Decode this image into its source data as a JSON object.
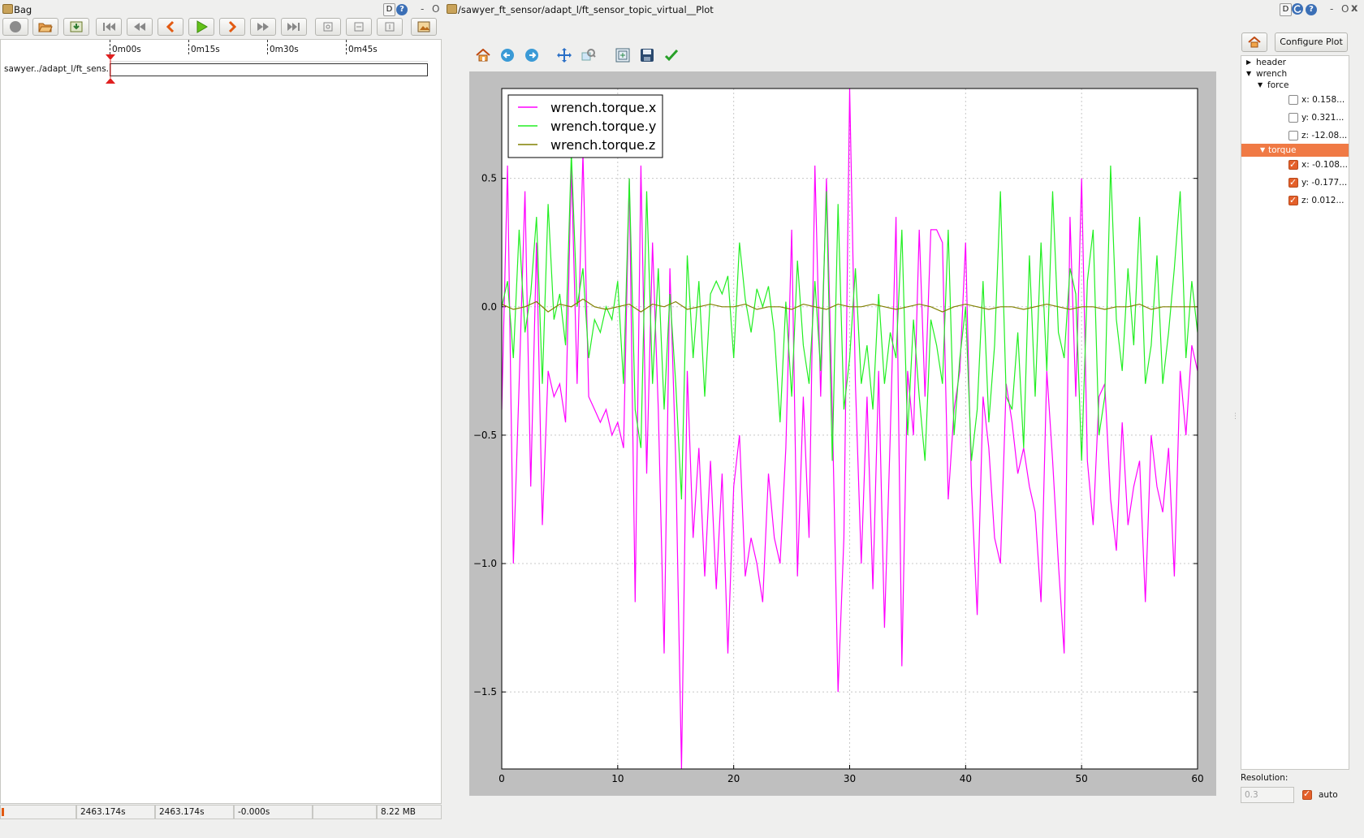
{
  "bag_window": {
    "title": "Bag",
    "min_label": "-",
    "close_label": "O",
    "d_label": "D",
    "help_label": "?",
    "topic_label": "sawyer../adapt_l/ft_sens..",
    "timeline_ticks": [
      "0m00s",
      "0m15s",
      "0m30s",
      "0m45s"
    ],
    "status": {
      "start_time": "2463.174s",
      "current_time": "2463.174s",
      "offset": "-0.000s",
      "empty": "",
      "size": "8.22 MB"
    }
  },
  "plot_window": {
    "title": "/sawyer_ft_sensor/adapt_l/ft_sensor_topic_virtual__Plot",
    "d_label": "D",
    "help_label": "?",
    "min_label": "-",
    "close_label": "O",
    "x_label": "x",
    "configure_label": "Configure Plot",
    "resolution_label": "Resolution:",
    "resolution_value": "0.3",
    "auto_label": "auto"
  },
  "topic_tree": {
    "header": "header",
    "wrench": "wrench",
    "force": "force",
    "force_items": [
      {
        "label": "x: 0.158...",
        "checked": false
      },
      {
        "label": "y: 0.321...",
        "checked": false
      },
      {
        "label": "z: -12.08...",
        "checked": false
      }
    ],
    "torque": "torque",
    "torque_items": [
      {
        "label": "x: -0.108...",
        "checked": true
      },
      {
        "label": "y: -0.177...",
        "checked": true
      },
      {
        "label": "z: 0.012...",
        "checked": true
      }
    ]
  },
  "colors": {
    "torque_x": "#ff00ff",
    "torque_y": "#22ee22",
    "torque_z": "#808000",
    "selection": "#f07a45",
    "bag_bar": "#1a1f7a"
  },
  "chart_data": {
    "type": "line",
    "xlim": [
      0,
      60
    ],
    "ylim": [
      -1.8,
      0.85
    ],
    "x_ticks": [
      "0",
      "10",
      "20",
      "30",
      "40",
      "50",
      "60"
    ],
    "y_ticks": [
      "0.5",
      "0.0",
      "−0.5",
      "−1.0",
      "−1.5"
    ],
    "grid": true,
    "legend_position": "top-left",
    "series": [
      {
        "name": "wrench.torque.x",
        "x": [
          0,
          0.5,
          1,
          1.5,
          2,
          2.5,
          3,
          3.5,
          4,
          4.5,
          5,
          5.5,
          6,
          6.5,
          7,
          7.5,
          8,
          8.5,
          9,
          9.5,
          10,
          10.5,
          11,
          11.5,
          12,
          12.5,
          13,
          13.5,
          14,
          14.5,
          15,
          15.5,
          16,
          16.5,
          17,
          17.5,
          18,
          18.5,
          19,
          19.5,
          20,
          20.5,
          21,
          21.5,
          22,
          22.5,
          23,
          23.5,
          24,
          24.5,
          25,
          25.5,
          26,
          26.5,
          27,
          27.5,
          28,
          28.5,
          29,
          29.5,
          30,
          30.5,
          31,
          31.5,
          32,
          32.5,
          33,
          33.5,
          34,
          34.5,
          35,
          35.5,
          36,
          36.5,
          37,
          37.5,
          38,
          38.5,
          39,
          39.5,
          40,
          40.5,
          41,
          41.5,
          42,
          42.5,
          43,
          43.5,
          44,
          44.5,
          45,
          45.5,
          46,
          46.5,
          47,
          47.5,
          48,
          48.5,
          49,
          49.5,
          50,
          50.5,
          51,
          51.5,
          52,
          52.5,
          53,
          53.5,
          54,
          54.5,
          55,
          55.5,
          56,
          56.5,
          57,
          57.5,
          58,
          58.5,
          59,
          59.5,
          60
        ],
        "values": [
          -0.4,
          0.55,
          -1.0,
          -0.3,
          0.45,
          -0.7,
          0.25,
          -0.85,
          -0.25,
          -0.35,
          -0.3,
          -0.45,
          0.55,
          -0.3,
          0.6,
          -0.35,
          -0.4,
          -0.45,
          -0.4,
          -0.5,
          -0.45,
          -0.55,
          0.5,
          -1.15,
          0.55,
          -0.65,
          0.25,
          -0.4,
          -1.35,
          0.15,
          -0.6,
          -1.8,
          -0.25,
          -0.9,
          -0.55,
          -1.05,
          -0.6,
          -1.1,
          -0.65,
          -1.35,
          -0.7,
          -0.5,
          -1.05,
          -0.9,
          -1.0,
          -1.15,
          -0.65,
          -0.9,
          -1.0,
          -0.55,
          0.3,
          -1.05,
          -0.35,
          -0.9,
          0.55,
          -0.35,
          0.5,
          -0.4,
          -1.5,
          -0.9,
          0.85,
          -0.3,
          -1.0,
          -0.35,
          -1.1,
          -0.25,
          -1.25,
          -0.5,
          0.35,
          -1.4,
          -0.25,
          -0.5,
          0.3,
          -0.35,
          0.3,
          0.3,
          0.25,
          -0.75,
          -0.4,
          -0.25,
          0.25,
          -0.7,
          -1.2,
          -0.35,
          -0.55,
          -0.9,
          -1.0,
          -0.3,
          -0.45,
          -0.65,
          -0.55,
          -0.7,
          -0.8,
          -1.15,
          -0.25,
          -0.6,
          -1.0,
          -1.35,
          0.35,
          -0.35,
          0.5,
          -0.6,
          -0.85,
          -0.35,
          -0.3,
          -0.75,
          -0.95,
          -0.45,
          -0.85,
          -0.7,
          -0.6,
          -1.15,
          -0.5,
          -0.7,
          -0.8,
          -0.55,
          -1.05,
          -0.25,
          -0.5,
          -0.15,
          -0.25
        ]
      },
      {
        "name": "wrench.torque.y",
        "x": [
          0,
          0.5,
          1,
          1.5,
          2,
          2.5,
          3,
          3.5,
          4,
          4.5,
          5,
          5.5,
          6,
          6.5,
          7,
          7.5,
          8,
          8.5,
          9,
          9.5,
          10,
          10.5,
          11,
          11.5,
          12,
          12.5,
          13,
          13.5,
          14,
          14.5,
          15,
          15.5,
          16,
          16.5,
          17,
          17.5,
          18,
          18.5,
          19,
          19.5,
          20,
          20.5,
          21,
          21.5,
          22,
          22.5,
          23,
          23.5,
          24,
          24.5,
          25,
          25.5,
          26,
          26.5,
          27,
          27.5,
          28,
          28.5,
          29,
          29.5,
          30,
          30.5,
          31,
          31.5,
          32,
          32.5,
          33,
          33.5,
          34,
          34.5,
          35,
          35.5,
          36,
          36.5,
          37,
          37.5,
          38,
          38.5,
          39,
          39.5,
          40,
          40.5,
          41,
          41.5,
          42,
          42.5,
          43,
          43.5,
          44,
          44.5,
          45,
          45.5,
          46,
          46.5,
          47,
          47.5,
          48,
          48.5,
          49,
          49.5,
          50,
          50.5,
          51,
          51.5,
          52,
          52.5,
          53,
          53.5,
          54,
          54.5,
          55,
          55.5,
          56,
          56.5,
          57,
          57.5,
          58,
          58.5,
          59,
          59.5,
          60
        ],
        "values": [
          0.0,
          0.1,
          -0.2,
          0.3,
          -0.1,
          0.05,
          0.35,
          -0.3,
          0.4,
          -0.05,
          0.05,
          -0.15,
          0.6,
          0.0,
          0.15,
          -0.2,
          -0.05,
          -0.1,
          0.0,
          -0.05,
          0.1,
          -0.3,
          0.5,
          -0.4,
          -0.55,
          0.45,
          -0.3,
          0.15,
          -0.4,
          0.05,
          -0.3,
          -0.75,
          0.2,
          -0.2,
          0.1,
          -0.35,
          0.05,
          0.1,
          0.05,
          0.12,
          -0.2,
          0.25,
          0.03,
          -0.1,
          0.07,
          0.0,
          0.08,
          -0.1,
          -0.45,
          0.02,
          -0.35,
          0.18,
          -0.15,
          -0.3,
          0.1,
          -0.25,
          0.45,
          -0.6,
          0.4,
          -0.4,
          -0.2,
          0.15,
          -0.3,
          -0.15,
          -0.4,
          0.05,
          -0.3,
          -0.1,
          -0.2,
          0.3,
          -0.5,
          -0.05,
          -0.35,
          -0.6,
          -0.05,
          -0.15,
          -0.3,
          0.3,
          -0.5,
          -0.2,
          0.0,
          -0.6,
          -0.4,
          0.1,
          -0.45,
          -0.15,
          0.45,
          -0.35,
          -0.4,
          -0.1,
          -0.55,
          0.2,
          -0.35,
          0.25,
          -0.25,
          0.45,
          -0.1,
          -0.2,
          0.15,
          0.05,
          -0.6,
          0.1,
          0.3,
          -0.5,
          -0.35,
          0.55,
          -0.05,
          -0.25,
          0.15,
          -0.15,
          0.35,
          -0.3,
          -0.15,
          0.2,
          -0.3,
          -0.1,
          0.15,
          0.45,
          -0.2,
          0.1,
          -0.1
        ]
      },
      {
        "name": "wrench.torque.z",
        "x": [
          0,
          1,
          2,
          3,
          4,
          5,
          6,
          7,
          8,
          9,
          10,
          11,
          12,
          13,
          14,
          15,
          16,
          17,
          18,
          19,
          20,
          21,
          22,
          23,
          24,
          25,
          26,
          27,
          28,
          29,
          30,
          31,
          32,
          33,
          34,
          35,
          36,
          37,
          38,
          39,
          40,
          41,
          42,
          43,
          44,
          45,
          46,
          47,
          48,
          49,
          50,
          51,
          52,
          53,
          54,
          55,
          56,
          57,
          58,
          59,
          60
        ],
        "values": [
          0.01,
          -0.01,
          0.0,
          0.02,
          -0.02,
          0.01,
          0.0,
          0.03,
          0.0,
          -0.01,
          0.0,
          0.01,
          -0.02,
          0.01,
          0.0,
          0.02,
          -0.01,
          0.0,
          0.01,
          0.0,
          0.0,
          0.01,
          -0.01,
          0.0,
          0.0,
          -0.01,
          0.01,
          0.0,
          -0.01,
          0.01,
          0.0,
          0.0,
          0.01,
          0.0,
          -0.01,
          0.0,
          0.01,
          0.0,
          -0.02,
          0.0,
          0.01,
          0.0,
          -0.01,
          0.0,
          0.0,
          -0.01,
          0.0,
          0.01,
          0.0,
          -0.01,
          0.0,
          0.0,
          -0.01,
          0.0,
          0.0,
          0.01,
          -0.01,
          0.0,
          0.0,
          0.0,
          0.0
        ]
      }
    ]
  }
}
